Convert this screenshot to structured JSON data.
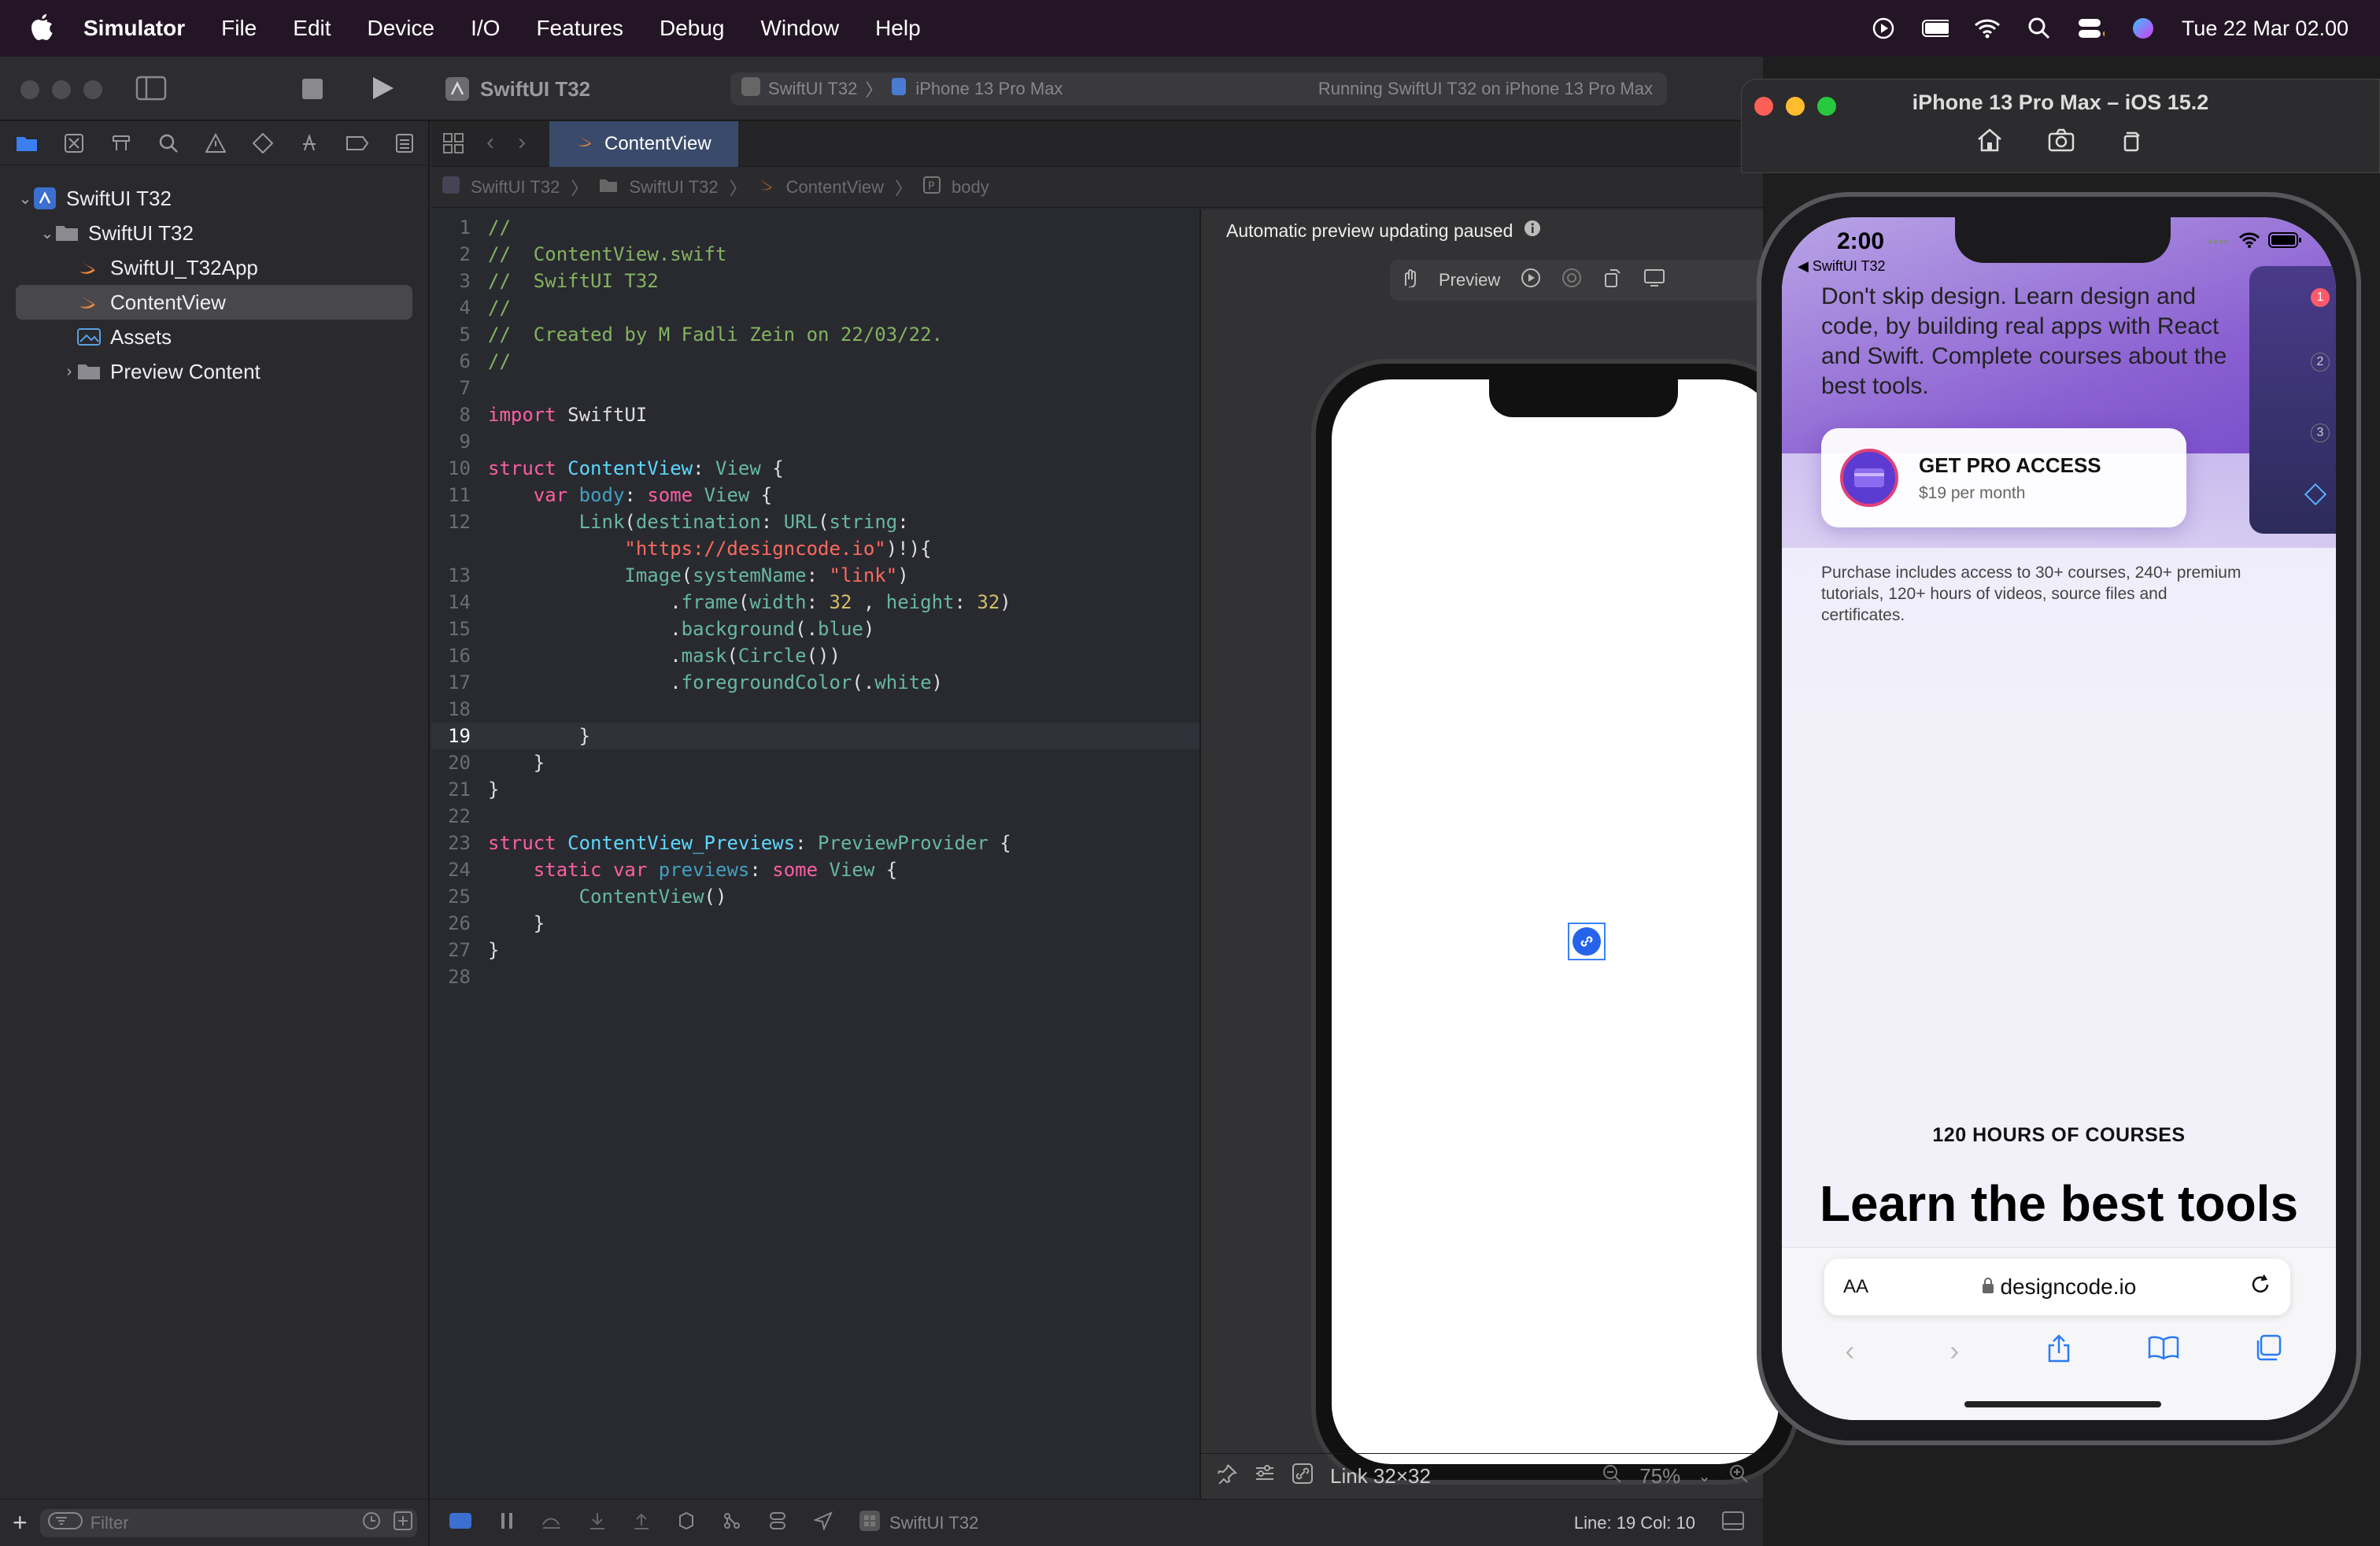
{
  "menubar": {
    "app_name": "Simulator",
    "items": [
      "File",
      "Edit",
      "Device",
      "I/O",
      "Features",
      "Debug",
      "Window",
      "Help"
    ],
    "datetime": "Tue 22 Mar  02.00"
  },
  "toolbar": {
    "project": "SwiftUI T32",
    "scheme": "SwiftUI T32",
    "destination": "iPhone 13 Pro Max",
    "status": "Running SwiftUI T32 on iPhone 13 Pro Max"
  },
  "navigator": {
    "items": [
      {
        "label": "SwiftUI T32",
        "level": 0
      },
      {
        "label": "SwiftUI T32",
        "level": 1
      },
      {
        "label": "SwiftUI_T32App",
        "level": 2
      },
      {
        "label": "ContentView",
        "level": 2
      },
      {
        "label": "Assets",
        "level": 2
      },
      {
        "label": "Preview Content",
        "level": 2
      }
    ],
    "filter_placeholder": "Filter"
  },
  "editor": {
    "tab": "ContentView",
    "breadcrumb": [
      "SwiftUI T32",
      "SwiftUI T32",
      "ContentView",
      "body"
    ],
    "current_line": 19
  },
  "preview": {
    "banner": "Automatic preview updating paused",
    "preview_label": "Preview",
    "selection": "Link 32×32",
    "zoom": "75%"
  },
  "statusbar": {
    "scheme": "SwiftUI T32",
    "position": "Line: 19  Col: 10"
  },
  "simulator": {
    "title": "iPhone 13 Pro Max – iOS 15.2",
    "time": "2:00",
    "back": "◀ SwiftUI T32",
    "hero": "Don't skip design. Learn design and code, by building real apps with React and Swift. Complete courses about the best tools.",
    "pro_title": "GET PRO ACCESS",
    "pro_price": "$19 per month",
    "purchase": "Purchase includes access to 30+ courses, 240+ premium tutorials, 120+ hours of videos, source files and certificates.",
    "hours": "120 HOURS OF COURSES",
    "headline": "Learn the best tools",
    "aa": "AA",
    "url": "designcode.io"
  },
  "colors": {
    "accent": "#2a7bf6",
    "menubar": "#241526",
    "editor_bg": "#292a30"
  }
}
